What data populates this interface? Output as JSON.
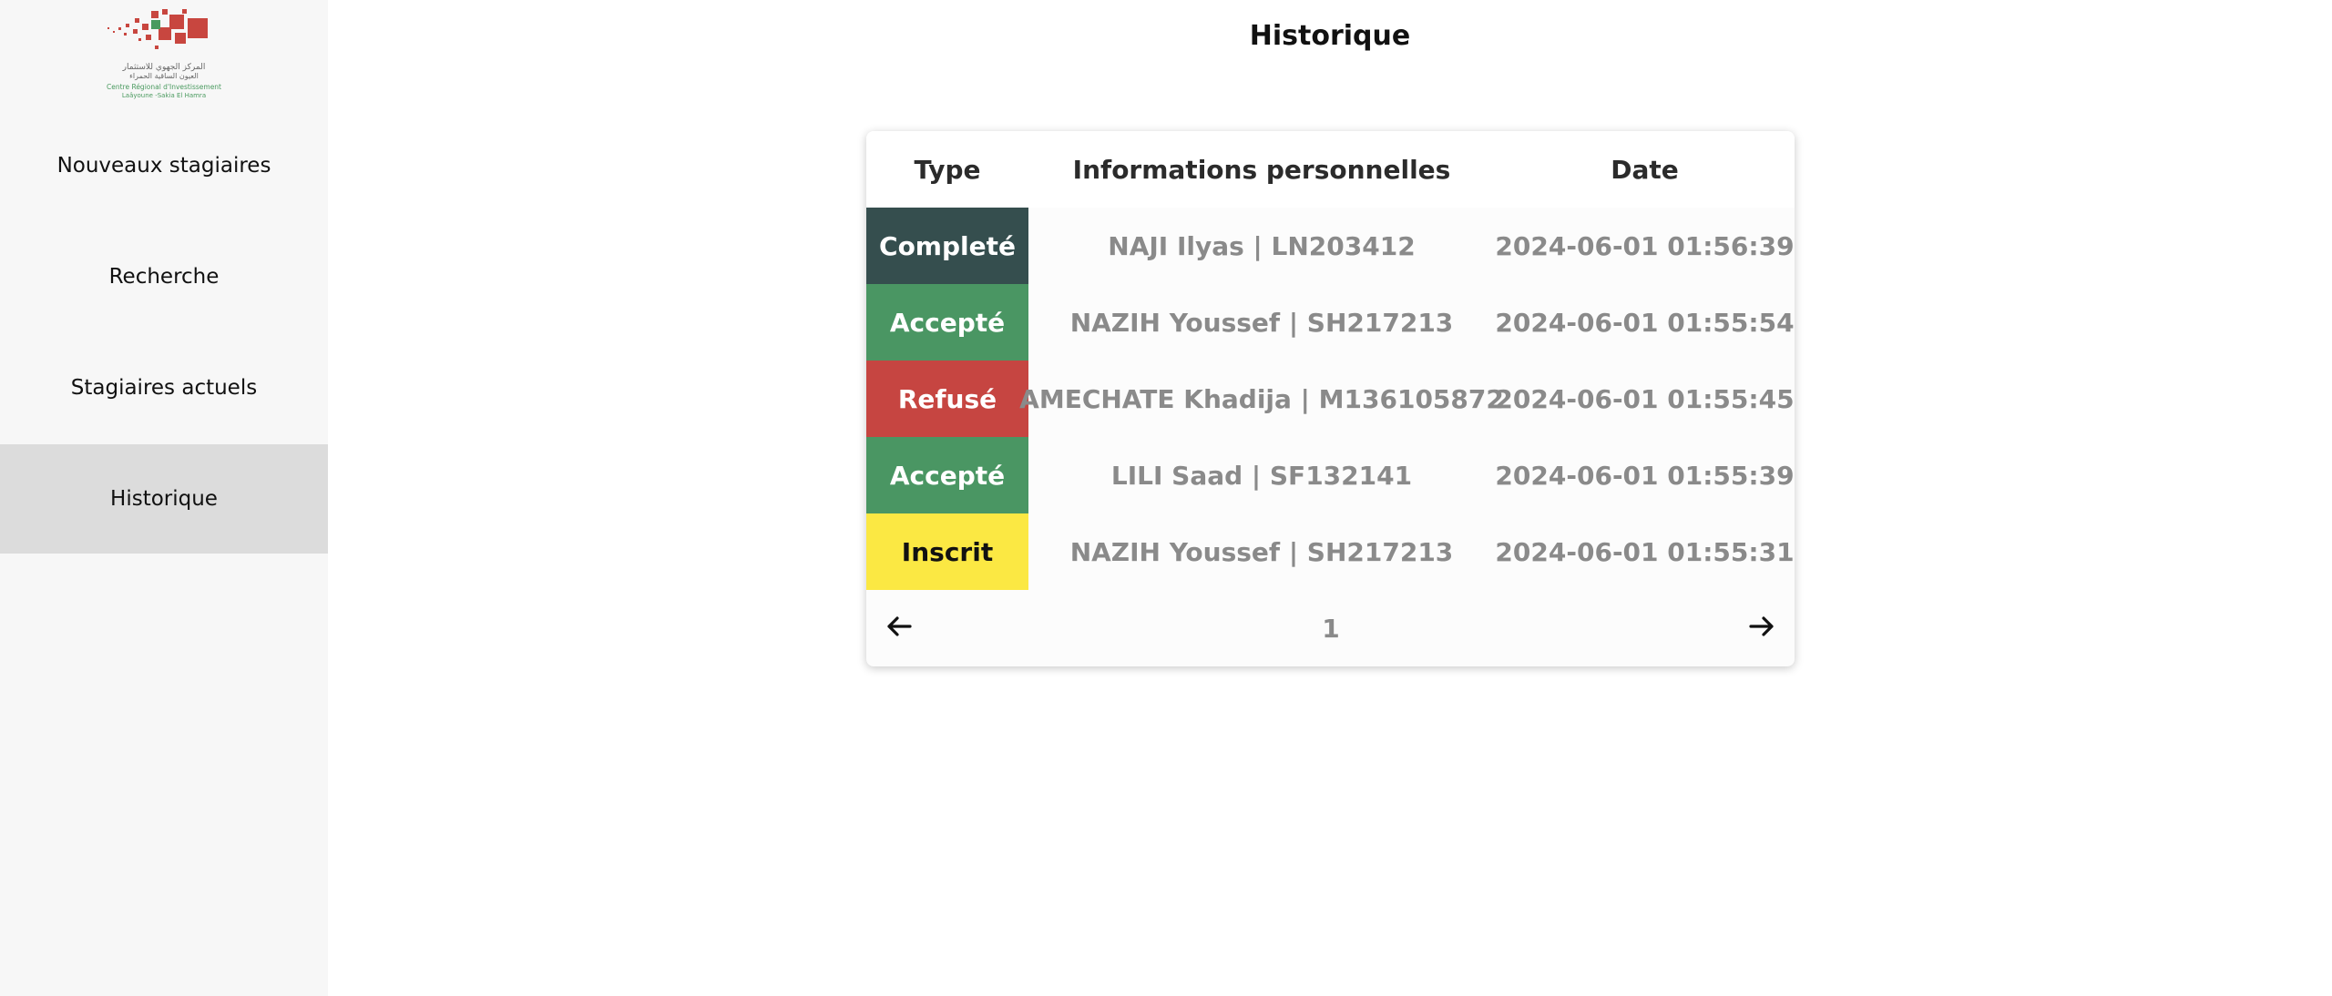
{
  "sidebar": {
    "logo": {
      "arabic_line1": "المركز الجهوي للاستثمار",
      "arabic_line2": "العيون الساقية الحمراء",
      "french_line1": "Centre Régional d'Investissement",
      "french_line2": "Laâyoune -Sakia El Hamra",
      "colors": {
        "red": "#c8463f",
        "green": "#4a9a5f"
      }
    },
    "items": [
      {
        "label": "Nouveaux stagiaires",
        "active": false
      },
      {
        "label": "Recherche",
        "active": false
      },
      {
        "label": "Stagiaires actuels",
        "active": false
      },
      {
        "label": "Historique",
        "active": true
      }
    ]
  },
  "page": {
    "title": "Historique"
  },
  "table": {
    "headers": [
      "Type",
      "Informations personnelles",
      "Date"
    ],
    "rows": [
      {
        "type": "Completé",
        "type_color": "#354e4e",
        "info": "NAJI Ilyas | LN203412",
        "date": "2024-06-01 01:56:39"
      },
      {
        "type": "Accepté",
        "type_color": "#4a9663",
        "info": "NAZIH Youssef | SH217213",
        "date": "2024-06-01 01:55:54"
      },
      {
        "type": "Refusé",
        "type_color": "#c64541",
        "info": "AMECHATE Khadija | M136105872",
        "date": "2024-06-01 01:55:45"
      },
      {
        "type": "Accepté",
        "type_color": "#4a9663",
        "info": "LILI Saad | SF132141",
        "date": "2024-06-01 01:55:39"
      },
      {
        "type": "Inscrit",
        "type_color": "#fbe843",
        "info": "NAZIH Youssef | SH217213",
        "date": "2024-06-01 01:55:31"
      }
    ]
  },
  "pagination": {
    "current_page": "1",
    "prev_icon": "arrow-left-icon",
    "next_icon": "arrow-right-icon"
  }
}
